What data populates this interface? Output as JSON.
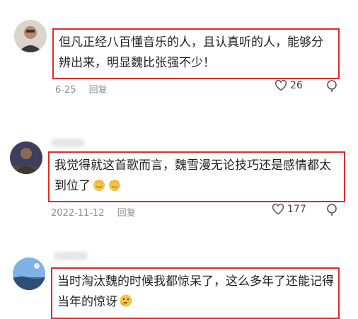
{
  "comments": [
    {
      "text": "但凡正经八百懂音乐的人，且认真听的人，能够分辨出来，明显魏比张强不少！",
      "date": "6-25",
      "reply_label": "回复",
      "likes": "26",
      "emojis": []
    },
    {
      "text": "我觉得就这首歌而言，魏雪漫无论技巧还是感情都太到位了",
      "date": "2022-11-12",
      "reply_label": "回复",
      "likes": "177",
      "emojis": [
        "clapping-hands",
        "clapping-hands"
      ]
    },
    {
      "text": "当时淘汰魏的时候我都惊呆了，这么多年了还能记得当年的惊讶",
      "date": "",
      "reply_label": "",
      "likes": "",
      "emojis": [
        "thinking-face"
      ]
    }
  ],
  "colors": {
    "highlight_border": "#e02a2a",
    "meta_text": "#8c8c8c"
  }
}
